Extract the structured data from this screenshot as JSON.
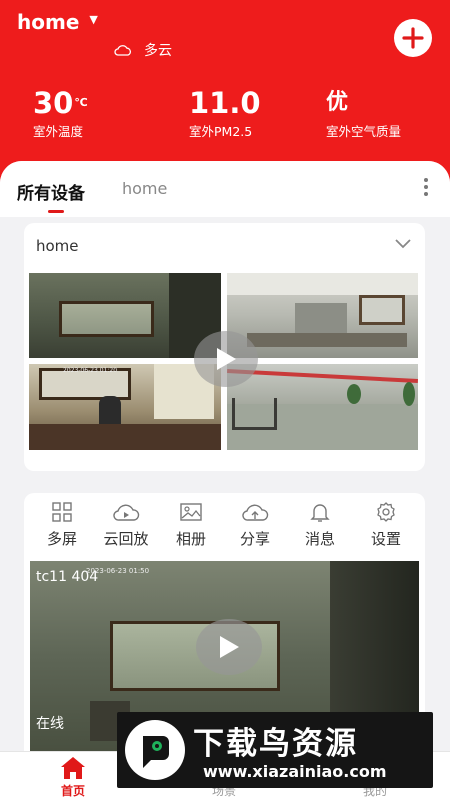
{
  "header": {
    "home_name": "home",
    "weather": "多云",
    "stats": [
      {
        "value": "30",
        "unit": "℃",
        "label": "室外温度"
      },
      {
        "value": "11.0",
        "unit": "",
        "label": "室外PM2.5"
      },
      {
        "value": "优",
        "unit": "",
        "label": "室外空气质量"
      }
    ],
    "accent_color": "#ee1c1c"
  },
  "tabs": {
    "all_devices": "所有设备",
    "home": "home"
  },
  "group_card": {
    "title": "home",
    "thumbnails": [
      {
        "timestamp": ""
      },
      {
        "timestamp": ""
      },
      {
        "timestamp": "2023-06-23 01:20"
      },
      {
        "timestamp": ""
      }
    ]
  },
  "toolbar": [
    {
      "label": "多屏",
      "icon": "grid-icon"
    },
    {
      "label": "云回放",
      "icon": "cloud-play-icon"
    },
    {
      "label": "相册",
      "icon": "image-icon"
    },
    {
      "label": "分享",
      "icon": "cloud-share-icon"
    },
    {
      "label": "消息",
      "icon": "bell-icon"
    },
    {
      "label": "设置",
      "icon": "gear-icon"
    }
  ],
  "camera": {
    "name": "tc11 404",
    "timestamp": "2023-06-23 01:50",
    "status": "在线"
  },
  "bottom_nav": [
    {
      "label": "首页",
      "icon": "home-icon"
    },
    {
      "label": "场景",
      "icon": "scene-icon"
    },
    {
      "label": "我的",
      "icon": "user-icon"
    }
  ],
  "watermark": {
    "title": "下载鸟资源",
    "url": "www.xiazainiao.com"
  }
}
